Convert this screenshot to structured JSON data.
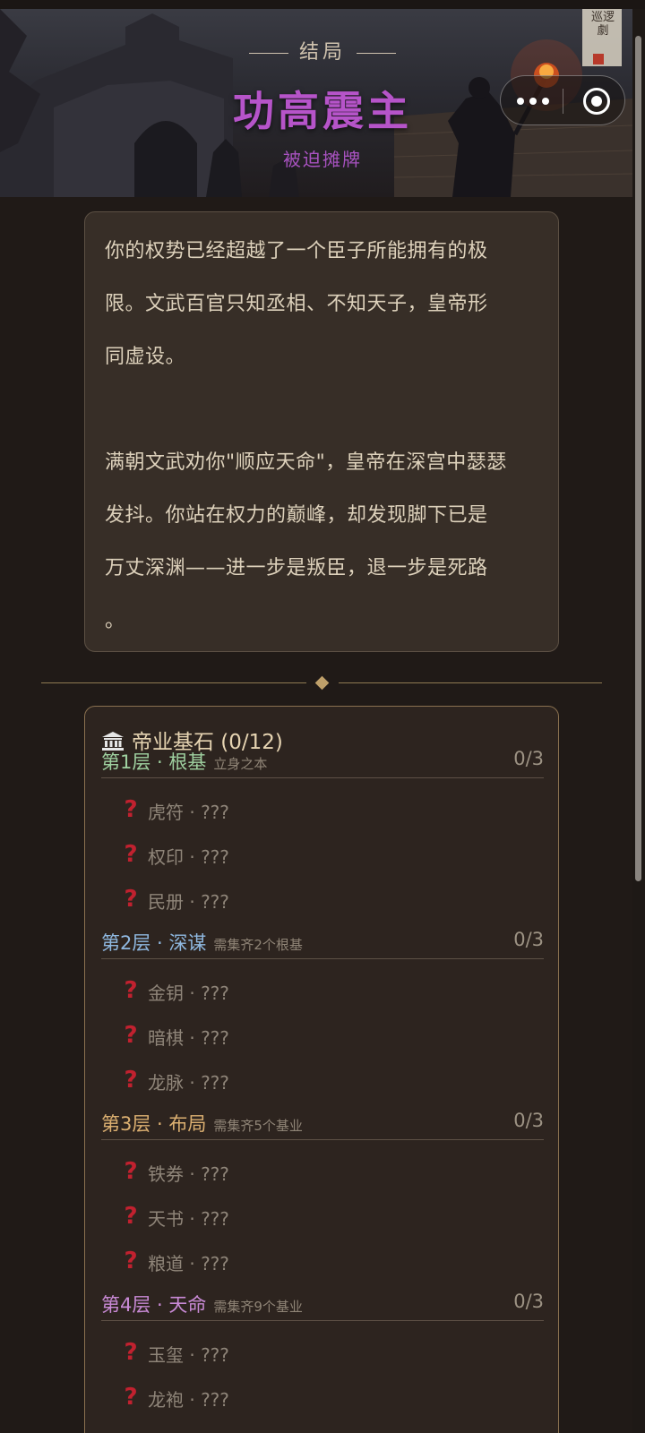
{
  "ending": {
    "kicker": "结局",
    "title": "功高震主",
    "subtitle": "被迫摊牌"
  },
  "banner_seal": "巡逻劇",
  "story": {
    "p1": [
      "你的权势已经超越了一个臣子所能拥有的极",
      "限。文武百官只知丞相、不知天子，皇帝形",
      "同虚设。"
    ],
    "p2": [
      "满朝文武劝你\"顺应天命\"，皇帝在深宫中瑟瑟",
      "发抖。你站在权力的巅峰，却发现脚下已是",
      "万丈深渊——进一步是叛臣，退一步是死路",
      "。"
    ]
  },
  "foundation": {
    "title": "帝业基石 (0/12)",
    "tiers": [
      {
        "name": "第1层 · 根基",
        "hint": "立身之本",
        "count": "0/3",
        "color": "#9fd1a0",
        "items": [
          "虎符 · ???",
          "权印 · ???",
          "民册 · ???"
        ]
      },
      {
        "name": "第2层 · 深谋",
        "hint": "需集齐2个根基",
        "count": "0/3",
        "color": "#8fb8e0",
        "items": [
          "金钥 · ???",
          "暗棋 · ???",
          "龙脉 · ???"
        ]
      },
      {
        "name": "第3层 · 布局",
        "hint": "需集齐5个基业",
        "count": "0/3",
        "color": "#dcb071",
        "items": [
          "铁券 · ???",
          "天书 · ???",
          "粮道 · ???"
        ]
      },
      {
        "name": "第4层 · 天命",
        "hint": "需集齐9个基业",
        "count": "0/3",
        "color": "#c98ad6",
        "items": [
          "玉玺 · ???",
          "龙袍 · ???"
        ]
      }
    ],
    "locked_mark": "?"
  }
}
